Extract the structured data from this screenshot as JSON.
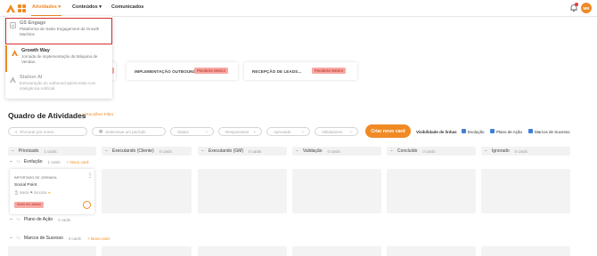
{
  "topbar": {
    "nav": [
      {
        "label": "Atividades",
        "active": true
      },
      {
        "label": "Conteúdos",
        "active": false
      },
      {
        "label": "Comunicados",
        "active": false
      }
    ],
    "avatar_initials": "MR",
    "accent": "#f08a24"
  },
  "dropdown": {
    "items": [
      {
        "title": "GS Engage",
        "description": "Plataforma de Sales Engagement da Growth Machine",
        "icon": "engage-icon"
      },
      {
        "title": "Growth Way",
        "description": "Jornada de implementação da Máquina de Vendas.",
        "icon": "mountain-icon"
      },
      {
        "title": "Station AI",
        "description": "Estruturação do outbound aprimorada com inteligência Artificial.",
        "icon": "station-icon"
      }
    ]
  },
  "stage_cards": [
    {
      "label": "IMPLEMENTAÇÃO OUTBOUND",
      "status": "Pendente Mentor"
    },
    {
      "label": "RECEPÇÃO DE LEADS...",
      "status": "Pendente Mentor"
    }
  ],
  "board": {
    "title": "Quadro de Atividades",
    "hide_filter": "Recolher Filtro",
    "filters": {
      "search_placeholder": "Procurar por nome...",
      "period_placeholder": "Selecionar um período",
      "status": "Status",
      "responsible": "Responsável",
      "approved": "Aprovado",
      "validators": "Validadores"
    },
    "new_card_button": "Criar novo card",
    "visibility_label": "Visibilidade de linhas",
    "visibility_options": [
      "Evolução",
      "Plano de Ação",
      "Marcos de Sucesso"
    ],
    "columns": [
      {
        "name": "Priorizado",
        "count": "1 cards"
      },
      {
        "name": "Executando (Cliente)",
        "count": "0 cards"
      },
      {
        "name": "Executando (GM)",
        "count": "0 cards"
      },
      {
        "name": "Validação",
        "count": "0 cards"
      },
      {
        "name": "Concluído",
        "count": "0 cards"
      },
      {
        "name": "Ignorado",
        "count": "0 cards"
      }
    ],
    "groups": [
      {
        "name": "Evolução",
        "count": "1 cards",
        "add": "+ Novo card"
      },
      {
        "name": "Plano de Ação",
        "count": "0 cards",
        "add": ""
      },
      {
        "name": "Marcos de Sucesso",
        "count": "0 cards",
        "add": "+ Novo card"
      }
    ],
    "card": {
      "category": "IMPORTADO DE JORNADA",
      "name": "Social Point",
      "created": "3/5/24",
      "due": "20/11/24",
      "tag": "Início em atraso"
    }
  }
}
